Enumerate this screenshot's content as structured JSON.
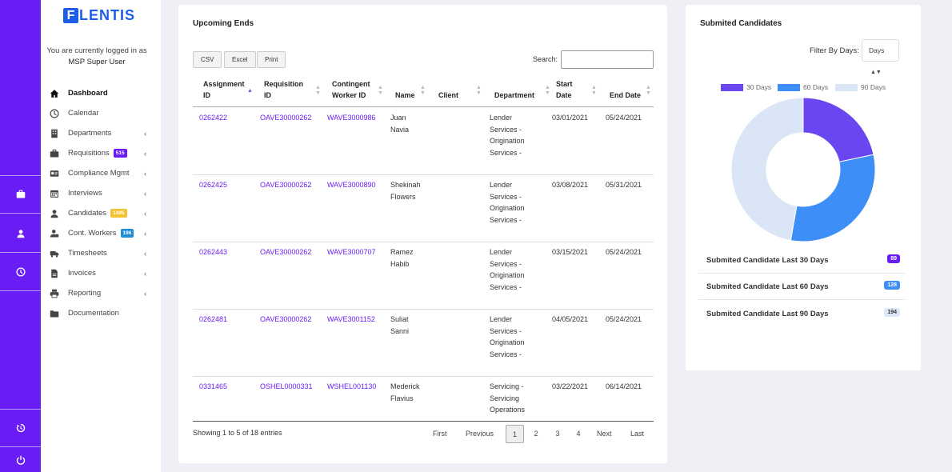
{
  "brand": {
    "logo_letter": "F",
    "logo_rest": "LENTIS",
    "primary": "#6a1cf5",
    "logo_color": "#1d5de8"
  },
  "user": {
    "status_line": "You are currently logged in as",
    "role": "MSP Super User"
  },
  "rail": [
    {
      "icon": "briefcase-icon"
    },
    {
      "icon": "user-icon"
    },
    {
      "icon": "clock-icon"
    },
    {
      "icon": "history-icon"
    },
    {
      "icon": "power-icon"
    }
  ],
  "sidebar": {
    "items": [
      {
        "label": "Dashboard",
        "icon": "home-icon",
        "active": true,
        "chevron": false,
        "badge": null
      },
      {
        "label": "Calendar",
        "icon": "calendar-clock-icon",
        "chevron": false,
        "badge": null
      },
      {
        "label": "Departments",
        "icon": "building-icon",
        "chevron": true,
        "badge": null
      },
      {
        "label": "Requisitions",
        "icon": "briefcase-icon",
        "chevron": true,
        "badge": "515",
        "badge_color": "#6a1cf5"
      },
      {
        "label": "Compliance Mgmt",
        "icon": "id-card-icon",
        "chevron": true,
        "badge": null
      },
      {
        "label": "Interviews",
        "icon": "calendar-icon",
        "chevron": true,
        "badge": null
      },
      {
        "label": "Candidates",
        "icon": "user-icon",
        "chevron": true,
        "badge": "1495",
        "badge_color": "#f2c230"
      },
      {
        "label": "Cont. Workers",
        "icon": "user-tie-icon",
        "chevron": true,
        "badge": "196",
        "badge_color": "#1e8fd6"
      },
      {
        "label": "Timesheets",
        "icon": "truck-icon",
        "chevron": true,
        "badge": null
      },
      {
        "label": "Invoices",
        "icon": "file-icon",
        "chevron": true,
        "badge": null
      },
      {
        "label": "Reporting",
        "icon": "printer-icon",
        "chevron": true,
        "badge": null
      },
      {
        "label": "Documentation",
        "icon": "folder-icon",
        "chevron": false,
        "badge": null
      }
    ]
  },
  "upcoming": {
    "title": "Upcoming Ends",
    "buttons": [
      "CSV",
      "Excel",
      "Print"
    ],
    "search_label": "Search:",
    "search_value": "",
    "columns": [
      [
        "Assignment",
        "ID"
      ],
      [
        "Requisition",
        "ID"
      ],
      [
        "Contingent",
        "Worker ID"
      ],
      [
        "",
        "Name"
      ],
      [
        "",
        "Client"
      ],
      [
        "",
        "Department"
      ],
      [
        "Start",
        "Date"
      ],
      [
        "",
        "End Date"
      ]
    ],
    "rows": [
      {
        "assignment": "0262422",
        "requisition": "OAVE30000262",
        "worker": "WAVE3000986",
        "name": [
          "Juan",
          "Navia"
        ],
        "client": "",
        "department": [
          "Lender",
          "Services -",
          "Origination",
          "Services -"
        ],
        "start": "03/01/2021",
        "end": "05/24/2021"
      },
      {
        "assignment": "0262425",
        "requisition": "OAVE30000262",
        "worker": "WAVE3000890",
        "name": [
          "Shekinah",
          "Flowers"
        ],
        "client": "",
        "department": [
          "Lender",
          "Services -",
          "Origination",
          "Services -"
        ],
        "start": "03/08/2021",
        "end": "05/31/2021"
      },
      {
        "assignment": "0262443",
        "requisition": "OAVE30000262",
        "worker": "WAVE3000707",
        "name": [
          "Ramez",
          "Habib"
        ],
        "client": "",
        "department": [
          "Lender",
          "Services -",
          "Origination",
          "Services -"
        ],
        "start": "03/15/2021",
        "end": "05/24/2021"
      },
      {
        "assignment": "0262481",
        "requisition": "OAVE30000262",
        "worker": "WAVE3001152",
        "name": [
          "Suliat",
          "Sanni"
        ],
        "client": "",
        "department": [
          "Lender",
          "Services -",
          "Origination",
          "Services -"
        ],
        "start": "04/05/2021",
        "end": "05/24/2021"
      },
      {
        "assignment": "0331465",
        "requisition": "OSHEL0000331",
        "worker": "WSHEL001130",
        "name": [
          "Mederick",
          "Flavius"
        ],
        "client": "",
        "department": [
          "Servicing -",
          "Servicing",
          "Operations"
        ],
        "start": "03/22/2021",
        "end": "06/14/2021"
      }
    ],
    "showing": "Showing 1 to 5 of 18 entries",
    "pagination": {
      "first": "First",
      "previous": "Previous",
      "pages": [
        "1",
        "2",
        "3",
        "4"
      ],
      "current": "1",
      "next": "Next",
      "last": "Last"
    }
  },
  "submitted": {
    "title": "Submited Candidates",
    "filter_label": "Filter By Days:",
    "filter_value": "Days",
    "stats": [
      {
        "label": "Submited Candidate Last 30 Days",
        "value": "89",
        "bg": "#6a1cf5",
        "fg": "#ffffff"
      },
      {
        "label": "Submited Candidate Last 60 Days",
        "value": "128",
        "bg": "#3e8ef7",
        "fg": "#ffffff"
      },
      {
        "label": "Submited Candidate Last 90 Days",
        "value": "194",
        "bg": "#dce8f8",
        "fg": "#333333"
      }
    ]
  },
  "chart_data": {
    "type": "pie",
    "title": "",
    "legend_position": "top",
    "categories": [
      "30 Days",
      "60 Days",
      "90 Days"
    ],
    "values": [
      89,
      128,
      194
    ],
    "colors": [
      "#6a46f0",
      "#3e8ef7",
      "#dae6f6"
    ],
    "hole": "donut"
  }
}
